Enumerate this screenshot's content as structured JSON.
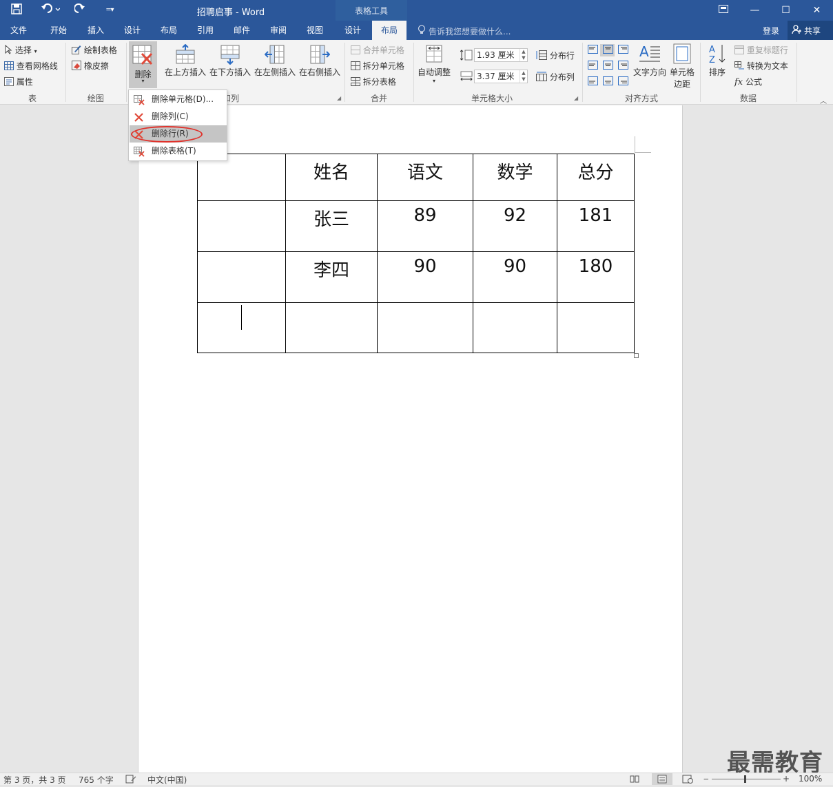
{
  "window": {
    "title": "招聘启事 - Word",
    "context_tab_title": "表格工具",
    "controls": {
      "restore_icon": "ribbon-display-icon",
      "minimize": "—",
      "maximize": "☐",
      "close": "✕"
    }
  },
  "quick_access": {
    "save_icon": "save-icon",
    "undo_icon": "undo-icon",
    "redo_icon": "redo-icon",
    "customize_icon": "customize-icon"
  },
  "tabs": [
    "文件",
    "开始",
    "插入",
    "设计",
    "布局",
    "引用",
    "邮件",
    "审阅",
    "视图",
    "设计",
    "布局"
  ],
  "active_tab": "布局",
  "tell_me": "告诉我您想要做什么...",
  "account": {
    "login": "登录",
    "share": "共享"
  },
  "ribbon": {
    "table_group": {
      "label": "表",
      "select": "选择",
      "gridlines": "查看网格线",
      "properties": "属性"
    },
    "draw_group": {
      "label": "绘图",
      "draw_table": "绘制表格",
      "eraser": "橡皮擦"
    },
    "rows_cols_group": {
      "label": "行和列",
      "label_visible": "和列",
      "delete": "删除",
      "insert_above": "在上方插入",
      "insert_below": "在下方插入",
      "insert_left": "在左侧插入",
      "insert_right": "在右侧插入"
    },
    "merge_group": {
      "label": "合并",
      "merge_cells": "合并单元格",
      "split_cells": "拆分单元格",
      "split_table": "拆分表格"
    },
    "cell_size_group": {
      "label": "单元格大小",
      "autofit": "自动调整",
      "height": "1.93 厘米",
      "width": "3.37 厘米",
      "distribute_rows": "分布行",
      "distribute_cols": "分布列"
    },
    "alignment_group": {
      "label": "对齐方式",
      "text_direction": "文字方向",
      "cell_margins_1": "单元格",
      "cell_margins_2": "边距"
    },
    "data_group": {
      "label": "数据",
      "sort": "排序",
      "repeat_header": "重复标题行",
      "convert_text": "转换为文本",
      "formula": "公式"
    }
  },
  "delete_menu": [
    {
      "label": "删除单元格(D)...",
      "icon": "delete-cells-icon"
    },
    {
      "label": "删除列(C)",
      "icon": "delete-columns-icon"
    },
    {
      "label": "删除行(R)",
      "icon": "delete-rows-icon",
      "highlighted": true
    },
    {
      "label": "删除表格(T)",
      "icon": "delete-table-icon"
    }
  ],
  "table": {
    "rows": [
      [
        "",
        "姓名",
        "语文",
        "数学",
        "总分"
      ],
      [
        "",
        "张三",
        "89",
        "92",
        "181"
      ],
      [
        "",
        "李四",
        "90",
        "90",
        "180"
      ],
      [
        "",
        "",
        "",
        "",
        ""
      ]
    ]
  },
  "watermark": "最需教育",
  "status": {
    "page": "第 3 页，共 3 页",
    "words": "765 个字",
    "language": "中文(中国)",
    "zoom": "100%"
  },
  "colors": {
    "brand": "#2b579a",
    "highlight_circle": "#e0322b",
    "menu_highlight": "#c5c5c5"
  }
}
